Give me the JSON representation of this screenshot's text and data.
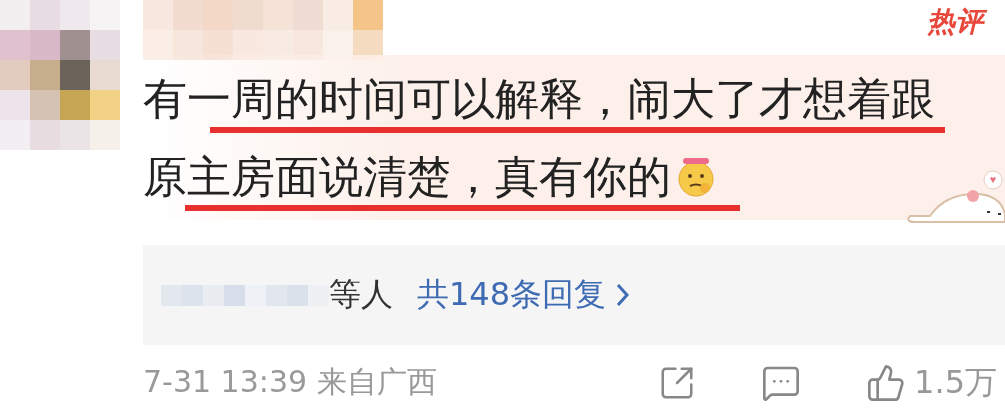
{
  "header": {
    "badge": "热评"
  },
  "comment": {
    "lines": [
      {
        "text": "有一周的时间可以解释，闹大了才想着跟",
        "underlined": true
      },
      {
        "text": "原主房面说清楚，真有你的",
        "underlined": true
      }
    ]
  },
  "replies": {
    "suffix": "等人",
    "count_link": "共148条回复"
  },
  "footer": {
    "meta": "7-31 13:39 来自广西",
    "likes": "1.5万"
  }
}
